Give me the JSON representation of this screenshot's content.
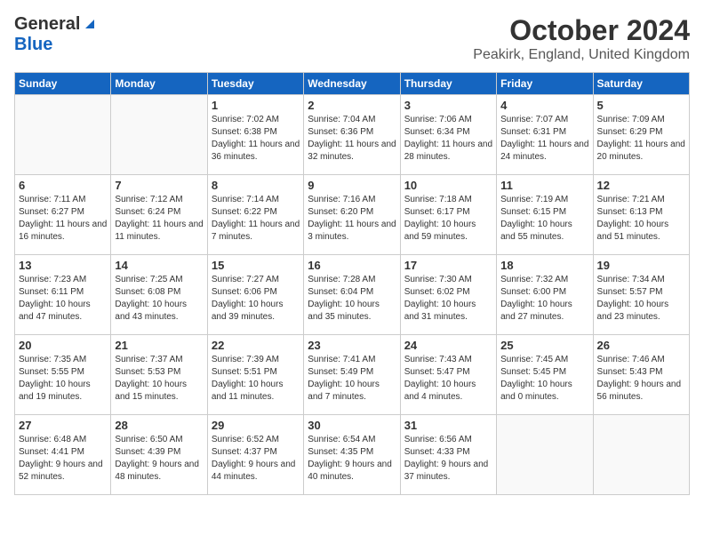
{
  "logo": {
    "general": "General",
    "blue": "Blue"
  },
  "title": "October 2024",
  "location": "Peakirk, England, United Kingdom",
  "days_of_week": [
    "Sunday",
    "Monday",
    "Tuesday",
    "Wednesday",
    "Thursday",
    "Friday",
    "Saturday"
  ],
  "weeks": [
    [
      {
        "day": "",
        "info": ""
      },
      {
        "day": "",
        "info": ""
      },
      {
        "day": "1",
        "info": "Sunrise: 7:02 AM\nSunset: 6:38 PM\nDaylight: 11 hours and 36 minutes."
      },
      {
        "day": "2",
        "info": "Sunrise: 7:04 AM\nSunset: 6:36 PM\nDaylight: 11 hours and 32 minutes."
      },
      {
        "day": "3",
        "info": "Sunrise: 7:06 AM\nSunset: 6:34 PM\nDaylight: 11 hours and 28 minutes."
      },
      {
        "day": "4",
        "info": "Sunrise: 7:07 AM\nSunset: 6:31 PM\nDaylight: 11 hours and 24 minutes."
      },
      {
        "day": "5",
        "info": "Sunrise: 7:09 AM\nSunset: 6:29 PM\nDaylight: 11 hours and 20 minutes."
      }
    ],
    [
      {
        "day": "6",
        "info": "Sunrise: 7:11 AM\nSunset: 6:27 PM\nDaylight: 11 hours and 16 minutes."
      },
      {
        "day": "7",
        "info": "Sunrise: 7:12 AM\nSunset: 6:24 PM\nDaylight: 11 hours and 11 minutes."
      },
      {
        "day": "8",
        "info": "Sunrise: 7:14 AM\nSunset: 6:22 PM\nDaylight: 11 hours and 7 minutes."
      },
      {
        "day": "9",
        "info": "Sunrise: 7:16 AM\nSunset: 6:20 PM\nDaylight: 11 hours and 3 minutes."
      },
      {
        "day": "10",
        "info": "Sunrise: 7:18 AM\nSunset: 6:17 PM\nDaylight: 10 hours and 59 minutes."
      },
      {
        "day": "11",
        "info": "Sunrise: 7:19 AM\nSunset: 6:15 PM\nDaylight: 10 hours and 55 minutes."
      },
      {
        "day": "12",
        "info": "Sunrise: 7:21 AM\nSunset: 6:13 PM\nDaylight: 10 hours and 51 minutes."
      }
    ],
    [
      {
        "day": "13",
        "info": "Sunrise: 7:23 AM\nSunset: 6:11 PM\nDaylight: 10 hours and 47 minutes."
      },
      {
        "day": "14",
        "info": "Sunrise: 7:25 AM\nSunset: 6:08 PM\nDaylight: 10 hours and 43 minutes."
      },
      {
        "day": "15",
        "info": "Sunrise: 7:27 AM\nSunset: 6:06 PM\nDaylight: 10 hours and 39 minutes."
      },
      {
        "day": "16",
        "info": "Sunrise: 7:28 AM\nSunset: 6:04 PM\nDaylight: 10 hours and 35 minutes."
      },
      {
        "day": "17",
        "info": "Sunrise: 7:30 AM\nSunset: 6:02 PM\nDaylight: 10 hours and 31 minutes."
      },
      {
        "day": "18",
        "info": "Sunrise: 7:32 AM\nSunset: 6:00 PM\nDaylight: 10 hours and 27 minutes."
      },
      {
        "day": "19",
        "info": "Sunrise: 7:34 AM\nSunset: 5:57 PM\nDaylight: 10 hours and 23 minutes."
      }
    ],
    [
      {
        "day": "20",
        "info": "Sunrise: 7:35 AM\nSunset: 5:55 PM\nDaylight: 10 hours and 19 minutes."
      },
      {
        "day": "21",
        "info": "Sunrise: 7:37 AM\nSunset: 5:53 PM\nDaylight: 10 hours and 15 minutes."
      },
      {
        "day": "22",
        "info": "Sunrise: 7:39 AM\nSunset: 5:51 PM\nDaylight: 10 hours and 11 minutes."
      },
      {
        "day": "23",
        "info": "Sunrise: 7:41 AM\nSunset: 5:49 PM\nDaylight: 10 hours and 7 minutes."
      },
      {
        "day": "24",
        "info": "Sunrise: 7:43 AM\nSunset: 5:47 PM\nDaylight: 10 hours and 4 minutes."
      },
      {
        "day": "25",
        "info": "Sunrise: 7:45 AM\nSunset: 5:45 PM\nDaylight: 10 hours and 0 minutes."
      },
      {
        "day": "26",
        "info": "Sunrise: 7:46 AM\nSunset: 5:43 PM\nDaylight: 9 hours and 56 minutes."
      }
    ],
    [
      {
        "day": "27",
        "info": "Sunrise: 6:48 AM\nSunset: 4:41 PM\nDaylight: 9 hours and 52 minutes."
      },
      {
        "day": "28",
        "info": "Sunrise: 6:50 AM\nSunset: 4:39 PM\nDaylight: 9 hours and 48 minutes."
      },
      {
        "day": "29",
        "info": "Sunrise: 6:52 AM\nSunset: 4:37 PM\nDaylight: 9 hours and 44 minutes."
      },
      {
        "day": "30",
        "info": "Sunrise: 6:54 AM\nSunset: 4:35 PM\nDaylight: 9 hours and 40 minutes."
      },
      {
        "day": "31",
        "info": "Sunrise: 6:56 AM\nSunset: 4:33 PM\nDaylight: 9 hours and 37 minutes."
      },
      {
        "day": "",
        "info": ""
      },
      {
        "day": "",
        "info": ""
      }
    ]
  ]
}
